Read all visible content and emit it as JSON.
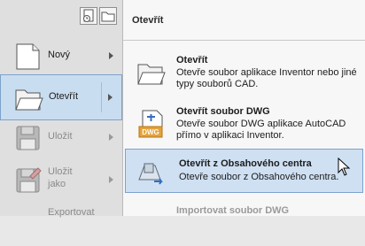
{
  "left_menu": {
    "items": [
      {
        "label": "Nový",
        "icon": "new-document-icon"
      },
      {
        "label": "Otevřít",
        "icon": "open-folder-icon"
      },
      {
        "label": "Uložit",
        "icon": "save-icon"
      },
      {
        "label": "Uložit jako",
        "line1": "Uložit",
        "line2": "jako",
        "icon": "save-as-icon"
      },
      {
        "label": "Exportovat",
        "icon": "export-icon"
      }
    ]
  },
  "submenu": {
    "title": "Otevřít",
    "items": [
      {
        "title": "Otevřít",
        "desc": "Otevře soubor aplikace Inventor nebo jiné typy souborů CAD.",
        "icon": "open-folder-icon"
      },
      {
        "title": "Otevřít soubor DWG",
        "desc": "Otevře soubor DWG aplikace AutoCAD přímo v aplikaci Inventor.",
        "icon": "dwg-file-icon",
        "badge": "DWG"
      },
      {
        "title": "Otevřít z Obsahového centra",
        "desc": "Otevře soubor z Obsahového centra.",
        "icon": "content-center-icon"
      },
      {
        "title": "Importovat soubor DWG",
        "icon": "import-dwg-icon"
      }
    ]
  },
  "colors": {
    "accent": "#7ba2cc",
    "highlight": "#cfe0f3"
  }
}
